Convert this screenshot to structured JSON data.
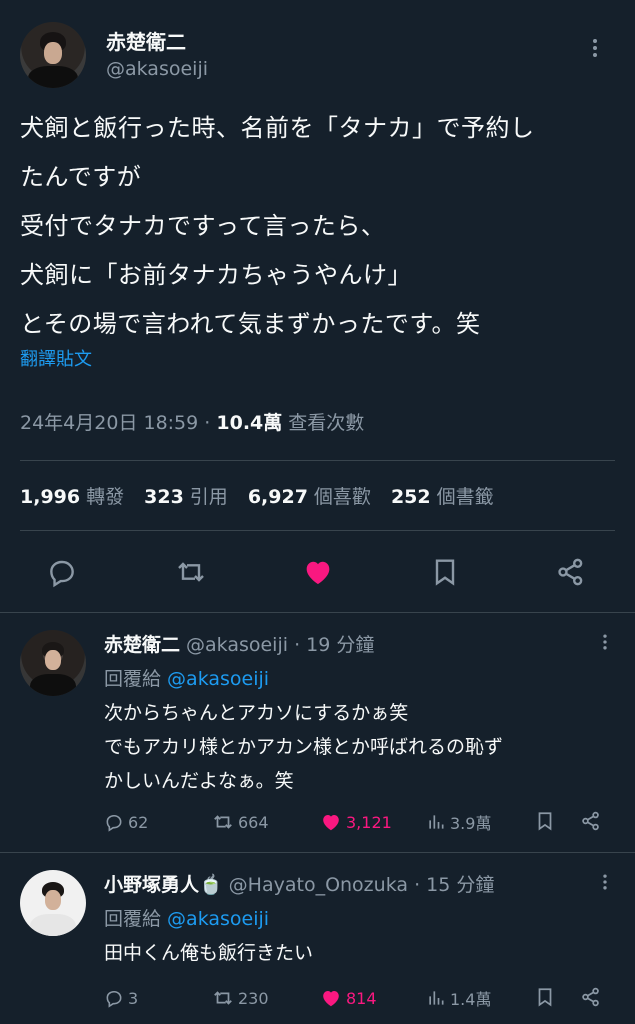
{
  "main_tweet": {
    "author_name": "赤楚衛二",
    "author_handle": "@akasoeiji",
    "text": "犬飼と飯行った時、名前を「タナカ」で予約し\nたんですが\n受付でタナカですって言ったら、\n犬飼に「お前タナカちゃうやんけ」\nとその場で言われて気まずかったです。笑",
    "translate_label": "翻譯貼文",
    "timestamp": "24年4月20日 18:59",
    "separator": " · ",
    "views": "10.4萬",
    "views_label": " 查看次數",
    "stats": {
      "retweets": "1,996",
      "retweets_label": "轉發",
      "quotes": "323",
      "quotes_label": "引用",
      "likes": "6,927",
      "likes_label": "個喜歡",
      "bookmarks": "252",
      "bookmarks_label": "個書籤"
    }
  },
  "replies": [
    {
      "author_name": "赤楚衛二",
      "author_handle": "@akasoeiji",
      "time": "· 19 分鐘",
      "reply_label": "回覆給 ",
      "reply_to": "@akasoeiji",
      "text": "次からちゃんとアカソにするかぁ笑\nでもアカリ様とかアカン様とか呼ばれるの恥ず\nかしいんだよなぁ。笑",
      "counts": {
        "replies": "62",
        "retweets": "664",
        "likes": "3,121",
        "views": "3.9萬"
      }
    },
    {
      "author_name": "小野塚勇人🍵",
      "author_handle": "@Hayato_Onozuka",
      "time": "· 15 分鐘",
      "reply_label": "回覆給 ",
      "reply_to": "@akasoeiji",
      "text": "田中くん俺も飯行きたい",
      "counts": {
        "replies": "3",
        "retweets": "230",
        "likes": "814",
        "views": "1.4萬"
      }
    }
  ],
  "colors": {
    "background": "#15202b",
    "text": "#f7f9f9",
    "muted": "#8b98a5",
    "link": "#1d9bf0",
    "like": "#f91880",
    "divider": "#38444d"
  },
  "icons": [
    "more-icon",
    "reply-icon",
    "retweet-icon",
    "heart-icon",
    "bookmark-icon",
    "share-icon",
    "views-icon"
  ]
}
